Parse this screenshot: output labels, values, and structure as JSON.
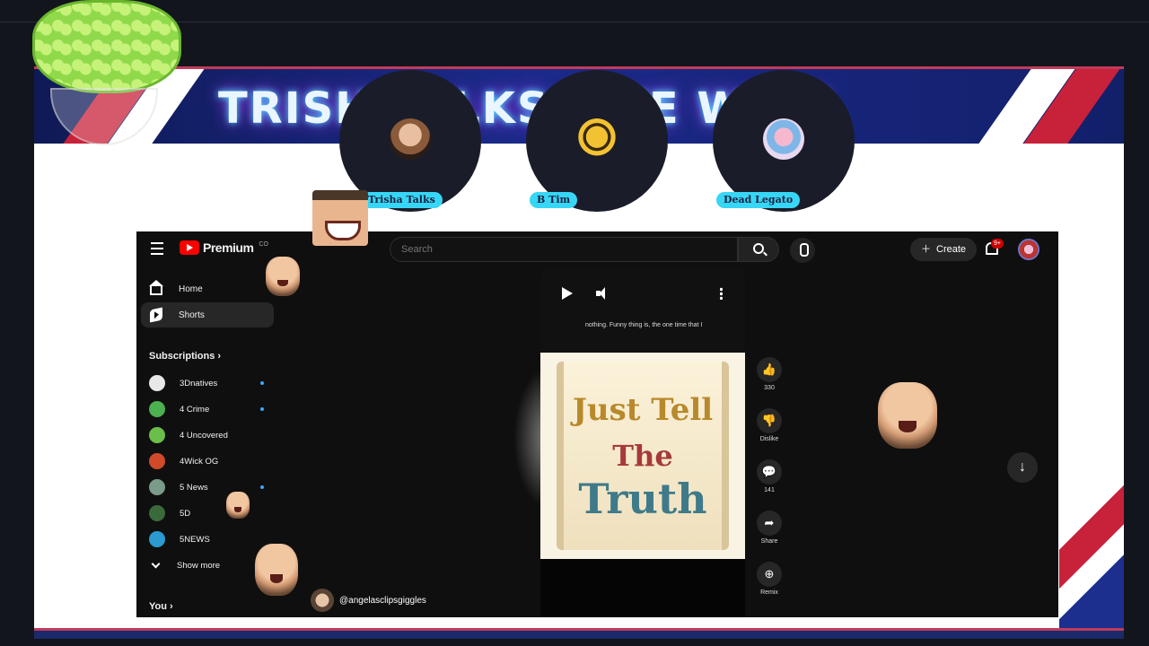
{
  "banner": {
    "title": "TRISH TALKS LIVE WICK"
  },
  "participants": [
    {
      "name": "Trisha Talks",
      "avatar_color": "#c89a78"
    },
    {
      "name": "B Tim",
      "avatar_color": "#d7a531"
    },
    {
      "name": "Dead Legato",
      "avatar_color": "#e8a7c3"
    }
  ],
  "youtube": {
    "logo_text": "Premium",
    "logo_sup": "CO",
    "search_placeholder": "Search",
    "create_label": "Create",
    "notification_badge": "9+",
    "sidebar": {
      "home": "Home",
      "shorts": "Shorts",
      "subscriptions_title": "Subscriptions",
      "subscriptions": [
        {
          "name": "3Dnatives",
          "color": "#e8e8e8",
          "new": true
        },
        {
          "name": "4 Crime",
          "color": "#4caf50",
          "new": true
        },
        {
          "name": "4 Uncovered",
          "color": "#6abf4b",
          "new": false
        },
        {
          "name": "4Wick OG",
          "color": "#d04a2a",
          "new": false
        },
        {
          "name": "5 News",
          "color": "#7a9a8a",
          "new": true
        },
        {
          "name": "5D",
          "color": "#3a6a3a",
          "new": false
        },
        {
          "name": "5NEWS",
          "color": "#2a9ad0",
          "new": false
        }
      ],
      "show_more": "Show more",
      "you_title": "You"
    },
    "short": {
      "caption": "nothing. Funny thing is, the one time that I",
      "image_text": [
        "Just Tell",
        "The",
        "Truth"
      ],
      "channel": "@angelasclipsgiggles",
      "actions": [
        {
          "icon": "thumbs-up-icon",
          "glyph": "👍",
          "label": "330"
        },
        {
          "icon": "thumbs-down-icon",
          "glyph": "👎",
          "label": "Dislike"
        },
        {
          "icon": "comment-icon",
          "glyph": "💬",
          "label": "141"
        },
        {
          "icon": "share-icon",
          "glyph": "➦",
          "label": "Share"
        },
        {
          "icon": "remix-icon",
          "glyph": "⊕",
          "label": "Remix"
        }
      ]
    }
  }
}
